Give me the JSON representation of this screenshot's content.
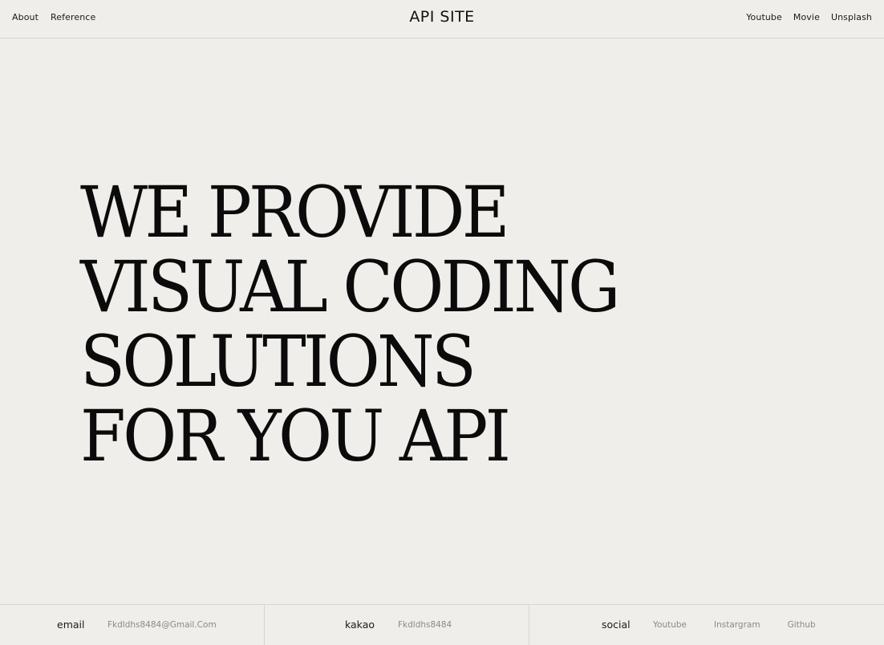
{
  "header": {
    "nav_left": [
      "About",
      "Reference"
    ],
    "logo": "API SITE",
    "nav_right": [
      "Youtube",
      "Movie",
      "Unsplash"
    ]
  },
  "hero": {
    "lines": [
      "WE PROVIDE",
      "VISUAL CODING",
      "SOLUTIONS",
      "FOR YOU API"
    ]
  },
  "footer": {
    "email": {
      "title": "email",
      "value": "Fkdldhs8484@Gmail.Com"
    },
    "kakao": {
      "title": "kakao",
      "value": "Fkdldhs8484"
    },
    "social": {
      "title": "social",
      "links": [
        "Youtube",
        "Instargram",
        "Github"
      ]
    }
  }
}
